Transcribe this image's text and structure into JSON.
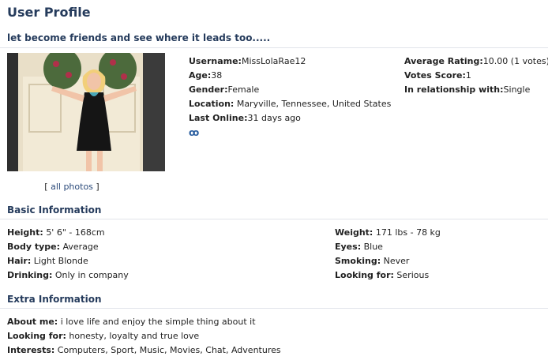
{
  "header": {
    "title": "User Profile",
    "tagline": "let become friends and see where it leads too....."
  },
  "photo": {
    "all_photos_label": "all photos"
  },
  "profile": {
    "username_label": "Username:",
    "username": "MissLolaRae12",
    "age_label": "Age:",
    "age": "38",
    "gender_label": "Gender:",
    "gender": "Female",
    "location_label": "Location:",
    "location": "Maryville, Tennessee, United States",
    "last_online_label": "Last Online:",
    "last_online": "31 days ago",
    "rating_label": "Average Rating:",
    "rating": "10.00 (1 votes)",
    "votes_label": "Votes Score:",
    "votes": "1",
    "relationship_label": "In relationship with:",
    "relationship": "Single"
  },
  "basic": {
    "heading": "Basic Information",
    "left": [
      {
        "label": "Height:",
        "value": "5' 6\" - 168cm"
      },
      {
        "label": "Body type:",
        "value": "Average"
      },
      {
        "label": "Hair:",
        "value": "Light Blonde"
      },
      {
        "label": "Drinking:",
        "value": "Only in company"
      }
    ],
    "right": [
      {
        "label": "Weight:",
        "value": "171 lbs - 78 kg"
      },
      {
        "label": "Eyes:",
        "value": "Blue"
      },
      {
        "label": "Smoking:",
        "value": "Never"
      },
      {
        "label": "Looking for:",
        "value": "Serious"
      }
    ]
  },
  "extra": {
    "heading": "Extra Information",
    "items": [
      {
        "label": "About me:",
        "value": "i love life and enjoy the simple thing about it"
      },
      {
        "label": "Looking for:",
        "value": "honesty, loyalty and true love"
      },
      {
        "label": "Interests:",
        "value": "Computers, Sport, Music, Movies, Chat, Adventures"
      }
    ]
  },
  "icons": {
    "share": "share-icon"
  }
}
